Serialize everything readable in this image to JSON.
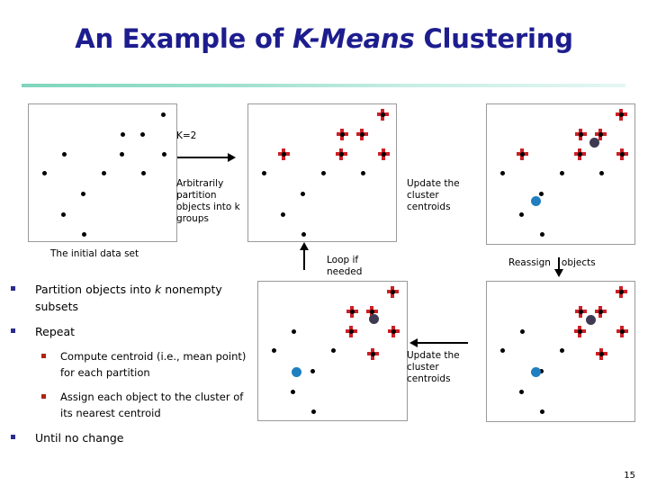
{
  "slide": {
    "title_prefix": "An Example of ",
    "title_italic": "K-Means",
    "title_suffix": " Clustering",
    "page_number": "15"
  },
  "annotations": {
    "k_value": "K=2",
    "arbitrarily_partition": "Arbitrarily partition objects into k groups",
    "initial_data_set": "The initial data set",
    "update_centroids_top": "Update the cluster centroids",
    "loop_if_needed": "Loop if needed",
    "reassign_objects_a": "Reassign",
    "reassign_objects_b": "objects",
    "update_centroids_bottom": "Update the cluster centroids"
  },
  "bullets": [
    {
      "level": 1,
      "marker_color": "#2b2b90",
      "pre": "Partition objects into ",
      "ital": "k",
      "post": " nonempty subsets"
    },
    {
      "level": 1,
      "marker_color": "#2b2b90",
      "pre": "Repeat",
      "ital": "",
      "post": ""
    },
    {
      "level": 2,
      "marker_color": "#b02318",
      "pre": "Compute centroid (i.e., mean point) for each partition",
      "ital": "",
      "post": ""
    },
    {
      "level": 2,
      "marker_color": "#b02318",
      "pre": "Assign each object to the cluster of its nearest centroid",
      "ital": "",
      "post": ""
    },
    {
      "level": 1,
      "marker_color": "#2b2b90",
      "pre": "Until no change",
      "ital": "",
      "post": ""
    }
  ],
  "colors": {
    "title": "#1d1d8f",
    "divider_start": "#7fd6bd",
    "divider_end": "#e4f7f2",
    "cross_red": "#cc2026",
    "dot_black": "#000000",
    "centroid_dark": "#3f3a52",
    "centroid_blue": "#1f7fc0",
    "bullet_blue": "#2b2b90",
    "bullet_red": "#b02318",
    "panel_border": "#9a9a9a"
  },
  "chart_data": {
    "type": "scatter",
    "title": "An Example of K-Means Clustering",
    "xlabel": "",
    "ylabel": "",
    "xlim": [
      0,
      166
    ],
    "ylim": [
      0,
      154
    ],
    "grid": false,
    "legend": "none",
    "note": "Five scatter panels illustrating k-means iterations; coordinates are panel-local pixels with origin at the panel's top-left corner.",
    "panels": [
      {
        "id": "panel-initial",
        "caption": "The initial data set",
        "points": [
          {
            "x": 149,
            "y": 11,
            "marker": "dot"
          },
          {
            "x": 104,
            "y": 33,
            "marker": "dot"
          },
          {
            "x": 126,
            "y": 33,
            "marker": "dot"
          },
          {
            "x": 39,
            "y": 55,
            "marker": "dot"
          },
          {
            "x": 103,
            "y": 55,
            "marker": "dot"
          },
          {
            "x": 150,
            "y": 55,
            "marker": "dot"
          },
          {
            "x": 17,
            "y": 76,
            "marker": "dot"
          },
          {
            "x": 83,
            "y": 76,
            "marker": "dot"
          },
          {
            "x": 127,
            "y": 76,
            "marker": "dot"
          },
          {
            "x": 60,
            "y": 99,
            "marker": "dot"
          },
          {
            "x": 38,
            "y": 122,
            "marker": "dot"
          },
          {
            "x": 61,
            "y": 144,
            "marker": "dot"
          }
        ],
        "centroids": []
      },
      {
        "id": "panel-partition",
        "caption": "Arbitrarily partition objects into k groups",
        "points": [
          {
            "x": 149,
            "y": 11,
            "marker": "cross"
          },
          {
            "x": 104,
            "y": 33,
            "marker": "cross"
          },
          {
            "x": 126,
            "y": 33,
            "marker": "cross"
          },
          {
            "x": 39,
            "y": 55,
            "marker": "cross"
          },
          {
            "x": 103,
            "y": 55,
            "marker": "cross"
          },
          {
            "x": 150,
            "y": 55,
            "marker": "cross"
          },
          {
            "x": 17,
            "y": 76,
            "marker": "dot"
          },
          {
            "x": 83,
            "y": 76,
            "marker": "dot"
          },
          {
            "x": 127,
            "y": 76,
            "marker": "dot"
          },
          {
            "x": 60,
            "y": 99,
            "marker": "dot"
          },
          {
            "x": 38,
            "y": 122,
            "marker": "dot"
          },
          {
            "x": 61,
            "y": 144,
            "marker": "dot"
          }
        ],
        "centroids": []
      },
      {
        "id": "panel-centroid1",
        "caption": "Update the cluster centroids",
        "points": [
          {
            "x": 149,
            "y": 11,
            "marker": "cross"
          },
          {
            "x": 104,
            "y": 33,
            "marker": "cross"
          },
          {
            "x": 126,
            "y": 33,
            "marker": "cross"
          },
          {
            "x": 39,
            "y": 55,
            "marker": "cross"
          },
          {
            "x": 103,
            "y": 55,
            "marker": "cross"
          },
          {
            "x": 150,
            "y": 55,
            "marker": "cross"
          },
          {
            "x": 17,
            "y": 76,
            "marker": "dot"
          },
          {
            "x": 83,
            "y": 76,
            "marker": "dot"
          },
          {
            "x": 127,
            "y": 76,
            "marker": "dot"
          },
          {
            "x": 60,
            "y": 99,
            "marker": "dot"
          },
          {
            "x": 38,
            "y": 122,
            "marker": "dot"
          },
          {
            "x": 61,
            "y": 144,
            "marker": "dot"
          }
        ],
        "centroids": [
          {
            "x": 119,
            "y": 42,
            "color": "dark"
          },
          {
            "x": 54,
            "y": 107,
            "color": "blue"
          }
        ]
      },
      {
        "id": "panel-reassign",
        "caption": "Update the cluster centroids",
        "points": [
          {
            "x": 149,
            "y": 11,
            "marker": "cross"
          },
          {
            "x": 104,
            "y": 33,
            "marker": "cross"
          },
          {
            "x": 126,
            "y": 33,
            "marker": "cross"
          },
          {
            "x": 39,
            "y": 55,
            "marker": "dot"
          },
          {
            "x": 103,
            "y": 55,
            "marker": "cross"
          },
          {
            "x": 150,
            "y": 55,
            "marker": "cross"
          },
          {
            "x": 17,
            "y": 76,
            "marker": "dot"
          },
          {
            "x": 83,
            "y": 76,
            "marker": "dot"
          },
          {
            "x": 127,
            "y": 80,
            "marker": "cross"
          },
          {
            "x": 60,
            "y": 99,
            "marker": "dot"
          },
          {
            "x": 38,
            "y": 122,
            "marker": "dot"
          },
          {
            "x": 61,
            "y": 144,
            "marker": "dot"
          }
        ],
        "centroids": [
          {
            "x": 128,
            "y": 41,
            "color": "dark"
          },
          {
            "x": 42,
            "y": 100,
            "color": "blue"
          }
        ]
      },
      {
        "id": "panel-centroid2",
        "caption": "Reassign objects",
        "points": [
          {
            "x": 149,
            "y": 11,
            "marker": "cross"
          },
          {
            "x": 104,
            "y": 33,
            "marker": "cross"
          },
          {
            "x": 126,
            "y": 33,
            "marker": "cross"
          },
          {
            "x": 39,
            "y": 55,
            "marker": "dot"
          },
          {
            "x": 103,
            "y": 55,
            "marker": "cross"
          },
          {
            "x": 150,
            "y": 55,
            "marker": "cross"
          },
          {
            "x": 17,
            "y": 76,
            "marker": "dot"
          },
          {
            "x": 83,
            "y": 76,
            "marker": "dot"
          },
          {
            "x": 127,
            "y": 80,
            "marker": "cross"
          },
          {
            "x": 60,
            "y": 99,
            "marker": "dot"
          },
          {
            "x": 38,
            "y": 122,
            "marker": "dot"
          },
          {
            "x": 61,
            "y": 144,
            "marker": "dot"
          }
        ],
        "centroids": [
          {
            "x": 115,
            "y": 42,
            "color": "dark"
          },
          {
            "x": 54,
            "y": 100,
            "color": "blue"
          }
        ]
      }
    ]
  }
}
